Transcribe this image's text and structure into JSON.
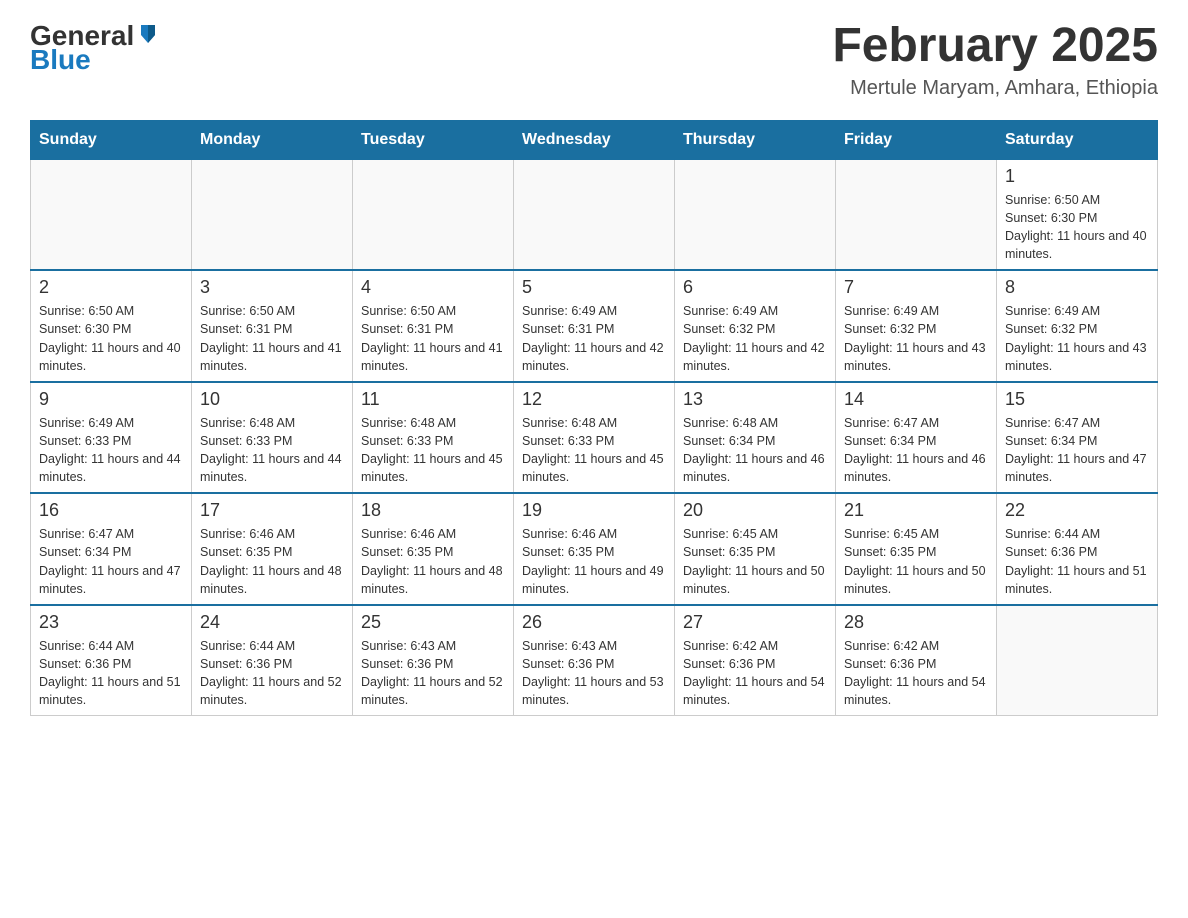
{
  "header": {
    "logo": {
      "general": "General",
      "blue": "Blue"
    },
    "title": "February 2025",
    "subtitle": "Mertule Maryam, Amhara, Ethiopia"
  },
  "days_of_week": [
    "Sunday",
    "Monday",
    "Tuesday",
    "Wednesday",
    "Thursday",
    "Friday",
    "Saturday"
  ],
  "weeks": [
    [
      {
        "day": "",
        "info": ""
      },
      {
        "day": "",
        "info": ""
      },
      {
        "day": "",
        "info": ""
      },
      {
        "day": "",
        "info": ""
      },
      {
        "day": "",
        "info": ""
      },
      {
        "day": "",
        "info": ""
      },
      {
        "day": "1",
        "info": "Sunrise: 6:50 AM\nSunset: 6:30 PM\nDaylight: 11 hours and 40 minutes."
      }
    ],
    [
      {
        "day": "2",
        "info": "Sunrise: 6:50 AM\nSunset: 6:30 PM\nDaylight: 11 hours and 40 minutes."
      },
      {
        "day": "3",
        "info": "Sunrise: 6:50 AM\nSunset: 6:31 PM\nDaylight: 11 hours and 41 minutes."
      },
      {
        "day": "4",
        "info": "Sunrise: 6:50 AM\nSunset: 6:31 PM\nDaylight: 11 hours and 41 minutes."
      },
      {
        "day": "5",
        "info": "Sunrise: 6:49 AM\nSunset: 6:31 PM\nDaylight: 11 hours and 42 minutes."
      },
      {
        "day": "6",
        "info": "Sunrise: 6:49 AM\nSunset: 6:32 PM\nDaylight: 11 hours and 42 minutes."
      },
      {
        "day": "7",
        "info": "Sunrise: 6:49 AM\nSunset: 6:32 PM\nDaylight: 11 hours and 43 minutes."
      },
      {
        "day": "8",
        "info": "Sunrise: 6:49 AM\nSunset: 6:32 PM\nDaylight: 11 hours and 43 minutes."
      }
    ],
    [
      {
        "day": "9",
        "info": "Sunrise: 6:49 AM\nSunset: 6:33 PM\nDaylight: 11 hours and 44 minutes."
      },
      {
        "day": "10",
        "info": "Sunrise: 6:48 AM\nSunset: 6:33 PM\nDaylight: 11 hours and 44 minutes."
      },
      {
        "day": "11",
        "info": "Sunrise: 6:48 AM\nSunset: 6:33 PM\nDaylight: 11 hours and 45 minutes."
      },
      {
        "day": "12",
        "info": "Sunrise: 6:48 AM\nSunset: 6:33 PM\nDaylight: 11 hours and 45 minutes."
      },
      {
        "day": "13",
        "info": "Sunrise: 6:48 AM\nSunset: 6:34 PM\nDaylight: 11 hours and 46 minutes."
      },
      {
        "day": "14",
        "info": "Sunrise: 6:47 AM\nSunset: 6:34 PM\nDaylight: 11 hours and 46 minutes."
      },
      {
        "day": "15",
        "info": "Sunrise: 6:47 AM\nSunset: 6:34 PM\nDaylight: 11 hours and 47 minutes."
      }
    ],
    [
      {
        "day": "16",
        "info": "Sunrise: 6:47 AM\nSunset: 6:34 PM\nDaylight: 11 hours and 47 minutes."
      },
      {
        "day": "17",
        "info": "Sunrise: 6:46 AM\nSunset: 6:35 PM\nDaylight: 11 hours and 48 minutes."
      },
      {
        "day": "18",
        "info": "Sunrise: 6:46 AM\nSunset: 6:35 PM\nDaylight: 11 hours and 48 minutes."
      },
      {
        "day": "19",
        "info": "Sunrise: 6:46 AM\nSunset: 6:35 PM\nDaylight: 11 hours and 49 minutes."
      },
      {
        "day": "20",
        "info": "Sunrise: 6:45 AM\nSunset: 6:35 PM\nDaylight: 11 hours and 50 minutes."
      },
      {
        "day": "21",
        "info": "Sunrise: 6:45 AM\nSunset: 6:35 PM\nDaylight: 11 hours and 50 minutes."
      },
      {
        "day": "22",
        "info": "Sunrise: 6:44 AM\nSunset: 6:36 PM\nDaylight: 11 hours and 51 minutes."
      }
    ],
    [
      {
        "day": "23",
        "info": "Sunrise: 6:44 AM\nSunset: 6:36 PM\nDaylight: 11 hours and 51 minutes."
      },
      {
        "day": "24",
        "info": "Sunrise: 6:44 AM\nSunset: 6:36 PM\nDaylight: 11 hours and 52 minutes."
      },
      {
        "day": "25",
        "info": "Sunrise: 6:43 AM\nSunset: 6:36 PM\nDaylight: 11 hours and 52 minutes."
      },
      {
        "day": "26",
        "info": "Sunrise: 6:43 AM\nSunset: 6:36 PM\nDaylight: 11 hours and 53 minutes."
      },
      {
        "day": "27",
        "info": "Sunrise: 6:42 AM\nSunset: 6:36 PM\nDaylight: 11 hours and 54 minutes."
      },
      {
        "day": "28",
        "info": "Sunrise: 6:42 AM\nSunset: 6:36 PM\nDaylight: 11 hours and 54 minutes."
      },
      {
        "day": "",
        "info": ""
      }
    ]
  ]
}
